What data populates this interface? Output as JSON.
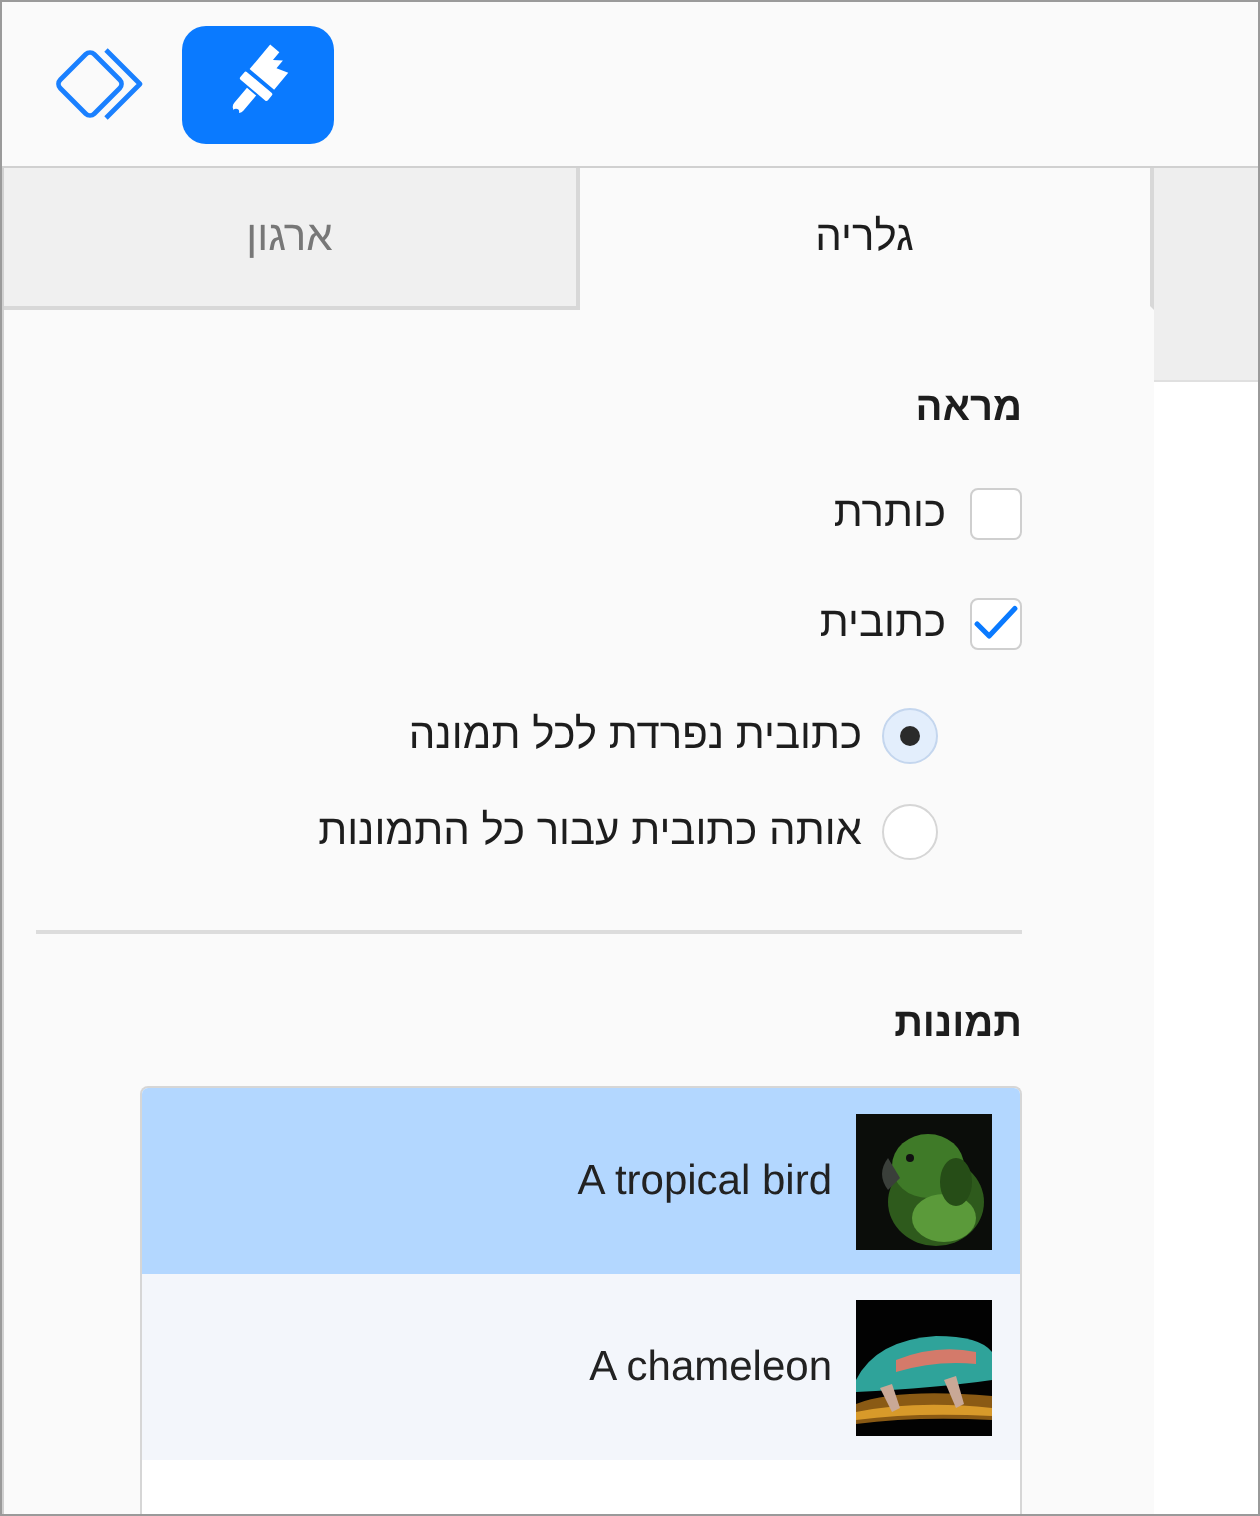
{
  "toolbar": {
    "buttons": [
      {
        "kind": "layers",
        "selected": false
      },
      {
        "kind": "brush",
        "selected": true
      }
    ]
  },
  "tabs": [
    {
      "label": "גלריה",
      "selected": true
    },
    {
      "label": "ארגון",
      "selected": false
    }
  ],
  "appearance": {
    "heading": "מראה",
    "options": [
      {
        "label": "כותרת",
        "checked": false
      },
      {
        "label": "כתובית",
        "checked": true
      }
    ],
    "caption_modes": [
      {
        "label": "כתובית נפרדת לכל תמונה",
        "selected": true
      },
      {
        "label": "אותה כתובית עבור כל התמונות",
        "selected": false
      }
    ]
  },
  "photos": {
    "heading": "תמונות",
    "items": [
      {
        "caption": "A tropical bird",
        "selected": true,
        "kind": "picture"
      },
      {
        "caption": "A chameleon",
        "selected": false,
        "kind": "picture"
      }
    ]
  }
}
